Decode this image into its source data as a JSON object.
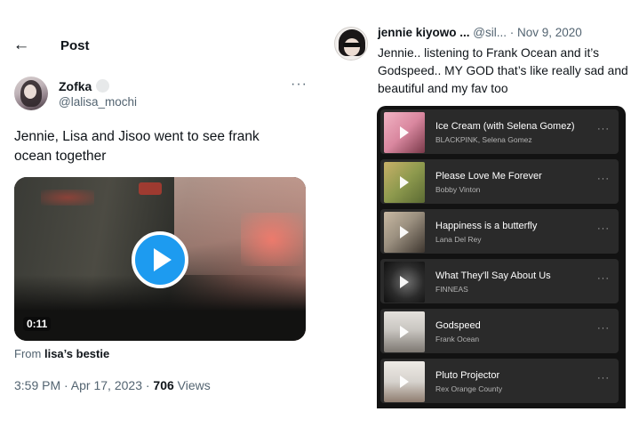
{
  "left_tweet": {
    "header_title": "Post",
    "author_name": "Zofka",
    "author_handle": "@lalisa_mochi",
    "text": "Jennie, Lisa and Jisoo went to see frank ocean together",
    "video_duration": "0:11",
    "from_prefix": "From",
    "from_source": "lisa’s bestie",
    "time": "3:59 PM · Apr 17, 2023 · ",
    "views_count": "706",
    "views_label": " Views",
    "more_label": "···"
  },
  "right_tweet": {
    "author_name": "jennie kiyowo ...",
    "author_handle": " @sil...",
    "date": " · Nov 9, 2020",
    "text": "Jennie.. listening to Frank Ocean and it’s Godspeed.. MY GOD that’s like really sad and beautiful and my fav too",
    "tracks": [
      {
        "title": "Ice Cream (with Selena Gomez)",
        "artist": "BLACKPINK, Selena Gomez",
        "cover_color": "#d98aa0"
      },
      {
        "title": "Please Love Me Forever",
        "artist": "Bobby Vinton",
        "cover_color": "#8e9a4e"
      },
      {
        "title": "Happiness is a butterfly",
        "artist": "Lana Del Rey",
        "cover_color": "#9a8f7f"
      },
      {
        "title": "What They'll Say About Us",
        "artist": "FINNEAS",
        "cover_color": "#2b2b2b"
      },
      {
        "title": "Godspeed",
        "artist": "Frank Ocean",
        "cover_color": "#c9c6c1"
      },
      {
        "title": "Pluto Projector",
        "artist": "Rex Orange County",
        "cover_color": "#d6d2cd"
      }
    ],
    "track_more": "···"
  },
  "colors": {
    "accent_blue": "#1d9bf0",
    "spotify_bg": "#121212",
    "track_bg": "#2a2a2a"
  }
}
